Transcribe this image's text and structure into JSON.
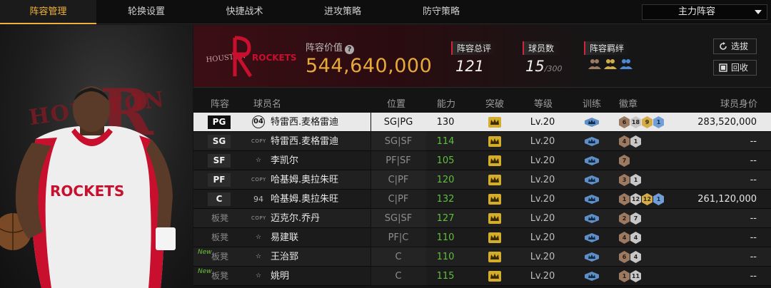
{
  "nav": {
    "tabs": [
      "阵容管理",
      "轮换设置",
      "快捷战术",
      "进攻策略",
      "防守策略"
    ],
    "active_tab": 0,
    "lineup_select": "主力阵容"
  },
  "team": {
    "logo_text": "ROCKETS",
    "logo_subtext": "HOUSTON",
    "value_label": "阵容价值",
    "value": "544,640,000"
  },
  "stats": {
    "overall_label": "阵容总评",
    "overall": "121",
    "players_label": "球员数",
    "players": "15",
    "players_max": "/300",
    "bond_label": "阵容羁绊"
  },
  "buttons": {
    "pick": "选拔",
    "recycle": "回收"
  },
  "columns": [
    "阵容",
    "球员名",
    "位置",
    "能力",
    "突破",
    "等级",
    "训练",
    "徽章",
    "球员身价"
  ],
  "rows": [
    {
      "pos": "PG",
      "bench": false,
      "new": false,
      "marker": "04",
      "marker_type": "num04",
      "name": "特雷西.麦格雷迪",
      "positions": "SG|PG",
      "rating": "130",
      "level": "Lv.20",
      "badges": [
        [
          "bronze",
          "6"
        ],
        [
          "silver",
          "18"
        ],
        [
          "gold",
          "9"
        ],
        [
          "blue",
          "1"
        ]
      ],
      "salary": "283,520,000",
      "selected": true
    },
    {
      "pos": "SG",
      "bench": false,
      "new": false,
      "marker": "COPY",
      "marker_type": "copy",
      "name": "特雷西.麦格雷迪",
      "positions": "SG|SF",
      "rating": "114",
      "level": "Lv.20",
      "badges": [
        [
          "bronze",
          "4"
        ],
        [
          "silver",
          "1"
        ]
      ],
      "salary": "--",
      "selected": false
    },
    {
      "pos": "SF",
      "bench": false,
      "new": false,
      "marker": "☆",
      "marker_type": "star",
      "name": "李凯尔",
      "positions": "PF|SF",
      "rating": "105",
      "level": "Lv.20",
      "badges": [
        [
          "bronze",
          "7"
        ]
      ],
      "salary": "--",
      "selected": false
    },
    {
      "pos": "PF",
      "bench": false,
      "new": false,
      "marker": "COPY",
      "marker_type": "copy",
      "name": "哈基姆.奥拉朱旺",
      "positions": "C|PF",
      "rating": "120",
      "level": "Lv.20",
      "badges": [
        [
          "bronze",
          "3"
        ],
        [
          "silver",
          "1"
        ]
      ],
      "salary": "--",
      "selected": false
    },
    {
      "pos": "C",
      "bench": false,
      "new": false,
      "marker": "94",
      "marker_type": "num94",
      "name": "哈基姆.奥拉朱旺",
      "positions": "C|PF",
      "rating": "132",
      "level": "Lv.20",
      "badges": [
        [
          "bronze",
          "1"
        ],
        [
          "silver",
          "12"
        ],
        [
          "gold",
          "12"
        ],
        [
          "blue",
          "1"
        ]
      ],
      "salary": "261,120,000",
      "selected": false
    },
    {
      "pos": "板凳",
      "bench": true,
      "new": false,
      "marker": "COPY",
      "marker_type": "copy",
      "name": "迈克尔.乔丹",
      "positions": "SG|SF",
      "rating": "127",
      "level": "Lv.20",
      "badges": [
        [
          "bronze",
          "2"
        ],
        [
          "silver",
          "7"
        ]
      ],
      "salary": "--",
      "selected": false
    },
    {
      "pos": "板凳",
      "bench": true,
      "new": false,
      "marker": "☆",
      "marker_type": "star",
      "name": "易建联",
      "positions": "PF|C",
      "rating": "110",
      "level": "Lv.20",
      "badges": [
        [
          "bronze",
          "4"
        ],
        [
          "silver",
          "4"
        ]
      ],
      "salary": "--",
      "selected": false
    },
    {
      "pos": "板凳",
      "bench": true,
      "new": true,
      "marker": "☆",
      "marker_type": "star",
      "name": "王治郅",
      "positions": "C",
      "rating": "110",
      "level": "Lv.20",
      "badges": [
        [
          "bronze",
          "6"
        ],
        [
          "silver",
          "4"
        ]
      ],
      "salary": "--",
      "selected": false
    },
    {
      "pos": "板凳",
      "bench": true,
      "new": true,
      "marker": "☆",
      "marker_type": "star",
      "name": "姚明",
      "positions": "C",
      "rating": "115",
      "level": "Lv.20",
      "badges": [
        [
          "bronze",
          "1"
        ],
        [
          "silver",
          "11"
        ]
      ],
      "salary": "--",
      "selected": false
    }
  ],
  "new_tag": "New",
  "hero": {
    "jersey_text": "ROCKETS"
  },
  "colors": {
    "accent": "#f0b23a",
    "value": "#e7a93a",
    "rating": "#5fbf3c",
    "team_red": "#c8102e"
  }
}
